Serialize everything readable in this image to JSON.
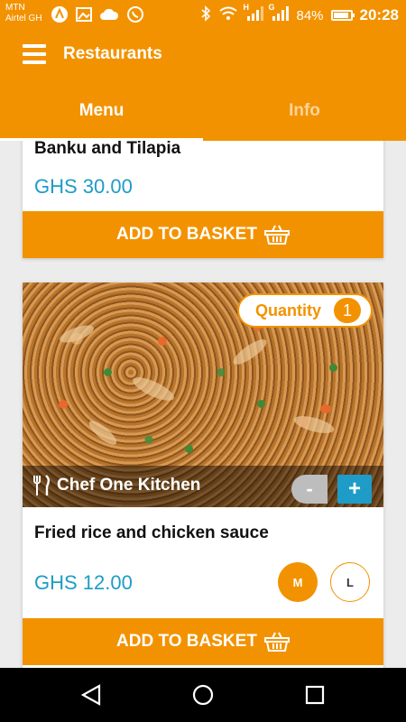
{
  "status_bar": {
    "carrier_1": "MTN",
    "carrier_2": "Airtel GH",
    "signal_1_label": "H",
    "signal_2_label": "G",
    "battery": "84%",
    "time": "20:28"
  },
  "toolbar": {
    "title": "Restaurants"
  },
  "tabs": [
    {
      "label": "Menu",
      "active": true
    },
    {
      "label": "Info",
      "active": false
    }
  ],
  "items": [
    {
      "name": "Banku and Tilapia",
      "price": "GHS 30.00",
      "button": "ADD TO BASKET"
    },
    {
      "name": "Fried rice and chicken sauce",
      "price": "GHS 12.00",
      "quantity_label": "Quantity",
      "quantity": "1",
      "kitchen": "Chef One Kitchen",
      "minus": "-",
      "plus": "+",
      "sizes": [
        "M",
        "L"
      ],
      "selected_size": "M",
      "button": "ADD TO BASKET"
    }
  ],
  "colors": {
    "brand": "#f39200",
    "price": "#1e9cc7",
    "minus": "#bdbdbd"
  }
}
